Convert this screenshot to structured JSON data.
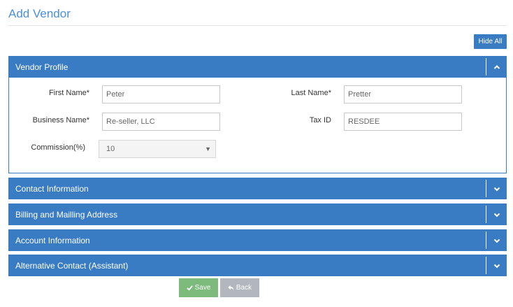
{
  "page": {
    "title": "Add Vendor"
  },
  "toolbar": {
    "hide_all_label": "Hide All"
  },
  "vendor_profile": {
    "header": "Vendor Profile",
    "first_name_label": "First Name*",
    "first_name_value": "Peter",
    "last_name_label": "Last Name*",
    "last_name_value": "Pretter",
    "business_name_label": "Business Name*",
    "business_name_value": "Re-seller, LLC",
    "tax_id_label": "Tax ID",
    "tax_id_value": "RESDEE",
    "commission_label": "Commission(%)",
    "commission_value": "10"
  },
  "sections": [
    {
      "label": "Contact Information"
    },
    {
      "label": "Billing and Mailling Address"
    },
    {
      "label": "Account Information"
    },
    {
      "label": "Alternative Contact (Assistant)"
    }
  ],
  "actions": {
    "save_label": "Save",
    "back_label": "Back"
  },
  "colors": {
    "panel_blue": "#3a7cc4",
    "save_green": "#7dbb7d",
    "back_gray": "#b2b7bd",
    "title_blue": "#4a90d9"
  },
  "icons": {
    "expanded": "chevron-up-icon",
    "collapsed": "chevron-down-icon",
    "save": "check-icon",
    "back": "reply-icon"
  }
}
